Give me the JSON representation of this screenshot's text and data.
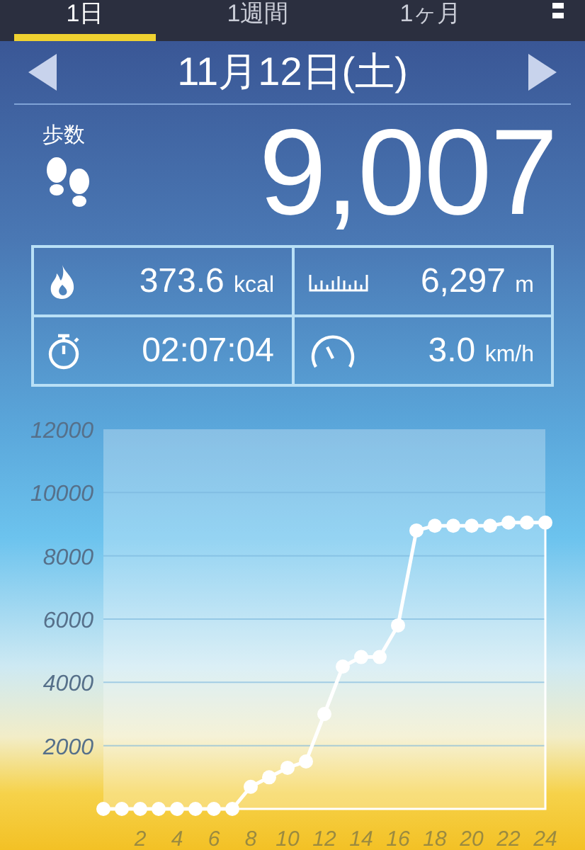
{
  "tabs": [
    {
      "label": "1日",
      "selected": true
    },
    {
      "label": "1週間",
      "selected": false
    },
    {
      "label": "1ヶ月",
      "selected": false
    }
  ],
  "date_nav": {
    "title": "11月12日(土)"
  },
  "steps": {
    "label": "歩数",
    "value": "9,007"
  },
  "stats": [
    {
      "kind": "calories",
      "value": "373.6",
      "unit": "kcal"
    },
    {
      "kind": "distance",
      "value": "6,297",
      "unit": "m"
    },
    {
      "kind": "duration",
      "value": "02:07:04"
    },
    {
      "kind": "speed",
      "value": "3.0",
      "unit": "km/h"
    }
  ],
  "chart": {
    "chart_data": {
      "type": "line",
      "x": [
        0,
        1,
        2,
        3,
        4,
        5,
        6,
        7,
        8,
        9,
        10,
        11,
        12,
        13,
        14,
        15,
        16,
        17,
        18,
        19,
        20,
        21,
        22,
        23,
        24
      ],
      "grid": true,
      "series": [
        {
          "color": "#ffffff",
          "marker": true,
          "values": [
            0,
            0,
            0,
            0,
            0,
            0,
            0,
            0,
            700,
            1000,
            1300,
            1500,
            3000,
            4500,
            4800,
            4800,
            5800,
            8800,
            8950,
            8950,
            8950,
            8950,
            9050,
            9050,
            9050
          ]
        }
      ],
      "xlim": [
        0,
        24
      ],
      "ylim": [
        0,
        12000
      ],
      "xticks": [
        2,
        4,
        6,
        8,
        10,
        12,
        14,
        16,
        18,
        20,
        22,
        24
      ],
      "yticks": [
        2000,
        4000,
        6000,
        8000,
        10000,
        12000
      ]
    }
  }
}
